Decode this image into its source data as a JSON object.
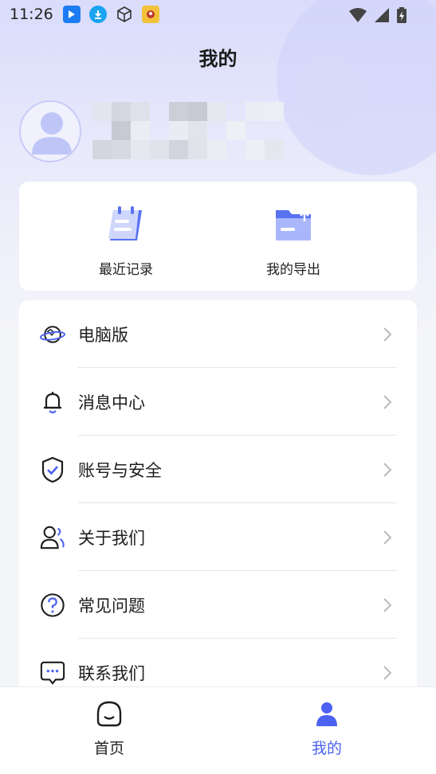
{
  "status_bar": {
    "time": "11:26"
  },
  "header": {
    "title": "我的"
  },
  "quick_actions": [
    {
      "label": "最近记录",
      "icon": "calendar-notes-icon"
    },
    {
      "label": "我的导出",
      "icon": "folder-export-icon"
    }
  ],
  "menu": [
    {
      "label": "电脑版",
      "icon": "planet-icon"
    },
    {
      "label": "消息中心",
      "icon": "bell-icon"
    },
    {
      "label": "账号与安全",
      "icon": "shield-check-icon"
    },
    {
      "label": "关于我们",
      "icon": "people-icon"
    },
    {
      "label": "常见问题",
      "icon": "question-icon"
    },
    {
      "label": "联系我们",
      "icon": "chat-bubble-icon"
    }
  ],
  "tabs": [
    {
      "label": "首页",
      "active": false
    },
    {
      "label": "我的",
      "active": true
    }
  ],
  "colors": {
    "accent": "#4c62f0",
    "text": "#1d1d1f",
    "inactive_tab": "#222222"
  }
}
